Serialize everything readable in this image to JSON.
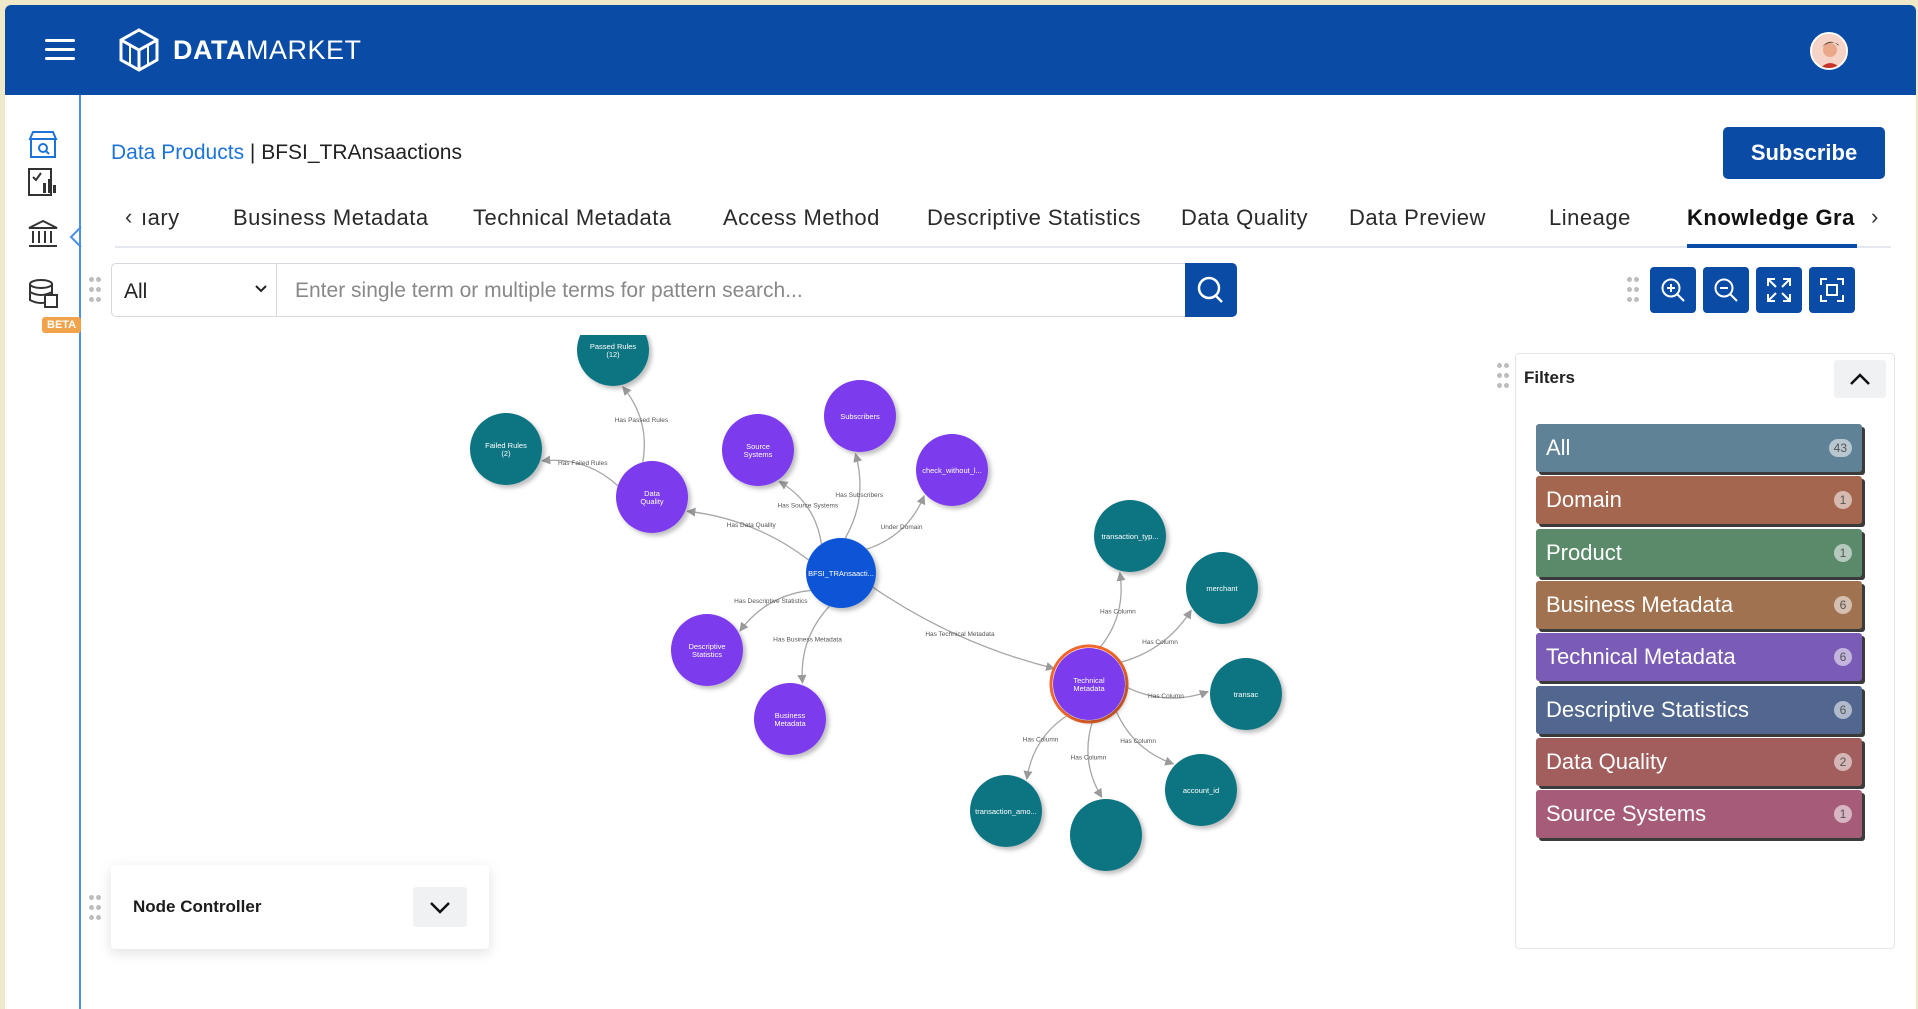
{
  "header": {
    "logo_bold": "DATA",
    "logo_thin": "MARKET"
  },
  "sidebar": {
    "beta_badge": "BETA"
  },
  "breadcrumb": {
    "link": "Data Products",
    "separator": " | ",
    "current": "BFSI_TRAnsaactions"
  },
  "subscribe_label": "Subscribe",
  "tabs": [
    {
      "label": "ıary"
    },
    {
      "label": "Business Metadata"
    },
    {
      "label": "Technical Metadata"
    },
    {
      "label": "Access Method"
    },
    {
      "label": "Descriptive Statistics"
    },
    {
      "label": "Data Quality"
    },
    {
      "label": "Data Preview"
    },
    {
      "label": "Lineage"
    },
    {
      "label": "Knowledge Gra"
    }
  ],
  "active_tab": "Knowledge Gra",
  "search": {
    "scope": "All",
    "placeholder": "Enter single term or multiple terms for pattern search..."
  },
  "graph": {
    "nodes": [
      {
        "id": "passed",
        "label": "Passed Rules (12)",
        "color": "#117482"
      },
      {
        "id": "failed",
        "label": "Failed Rules (2)",
        "color": "#117482"
      },
      {
        "id": "dq",
        "label": "Data Quality",
        "color": "#7c3aed"
      },
      {
        "id": "src",
        "label": "Source Systems",
        "color": "#7c3aed"
      },
      {
        "id": "subs",
        "label": "Subscribers",
        "color": "#7c3aed"
      },
      {
        "id": "check",
        "label": "check_without_l...",
        "color": "#7c3aed"
      },
      {
        "id": "bfsi",
        "label": "BFSI_TRAnsaacti...",
        "color": "#0a55d6"
      },
      {
        "id": "desc",
        "label": "Descriptive Statistics",
        "color": "#7c3aed"
      },
      {
        "id": "bm",
        "label": "Business Metadata",
        "color": "#7c3aed"
      },
      {
        "id": "tm",
        "label": "Technical Metadata",
        "color": "#7c3aed"
      },
      {
        "id": "ttype",
        "label": "transaction_typ...",
        "color": "#117482"
      },
      {
        "id": "merch",
        "label": "merchant",
        "color": "#117482"
      },
      {
        "id": "trans",
        "label": "transac",
        "color": "#117482"
      },
      {
        "id": "acct",
        "label": "account_id",
        "color": "#117482"
      },
      {
        "id": "tamt",
        "label": "transaction_amo...",
        "color": "#117482"
      },
      {
        "id": "bottom",
        "label": "",
        "color": "#117482"
      }
    ],
    "edges": [
      {
        "from": "dq",
        "to": "passed",
        "label": "Has Passed Rules"
      },
      {
        "from": "dq",
        "to": "failed",
        "label": "Has Failed Rules"
      },
      {
        "from": "bfsi",
        "to": "dq",
        "label": "Has Data Quality"
      },
      {
        "from": "bfsi",
        "to": "src",
        "label": "Has Source Systems"
      },
      {
        "from": "bfsi",
        "to": "subs",
        "label": "Has Subscribers"
      },
      {
        "from": "bfsi",
        "to": "check",
        "label": "Under Domain"
      },
      {
        "from": "bfsi",
        "to": "desc",
        "label": "Has Descriptive Statistics"
      },
      {
        "from": "bfsi",
        "to": "bm",
        "label": "Has Business Metadata"
      },
      {
        "from": "bfsi",
        "to": "tm",
        "label": "Has Technical Metadata"
      },
      {
        "from": "tm",
        "to": "ttype",
        "label": "Has Column"
      },
      {
        "from": "tm",
        "to": "merch",
        "label": "Has Column"
      },
      {
        "from": "tm",
        "to": "trans",
        "label": "Has Column"
      },
      {
        "from": "tm",
        "to": "acct",
        "label": "Has Column"
      },
      {
        "from": "tm",
        "to": "tamt",
        "label": "Has Column"
      },
      {
        "from": "tm",
        "to": "bottom",
        "label": "Has Column"
      }
    ]
  },
  "filters": {
    "title": "Filters",
    "items": [
      {
        "label": "All",
        "count": "43",
        "color": "#5f8296"
      },
      {
        "label": "Domain",
        "count": "1",
        "color": "#a4664f"
      },
      {
        "label": "Product",
        "count": "1",
        "color": "#5b8a6a"
      },
      {
        "label": "Business Metadata",
        "count": "6",
        "color": "#a07250"
      },
      {
        "label": "Technical Metadata",
        "count": "6",
        "color": "#7a5bb6"
      },
      {
        "label": "Descriptive Statistics",
        "count": "6",
        "color": "#52678f"
      },
      {
        "label": "Data Quality",
        "count": "2",
        "color": "#a25d5d"
      },
      {
        "label": "Source Systems",
        "count": "1",
        "color": "#a65c79"
      }
    ]
  },
  "node_controller": {
    "title": "Node Controller"
  }
}
